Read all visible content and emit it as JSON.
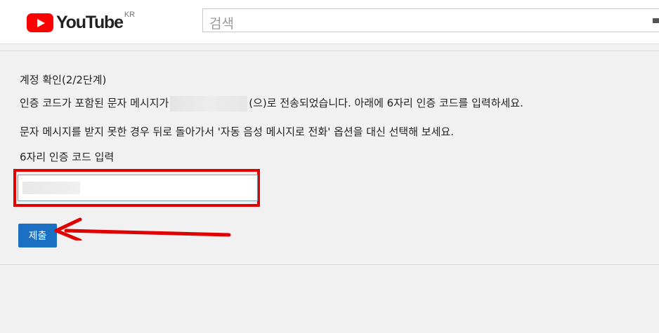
{
  "header": {
    "logo_text": "YouTube",
    "region_badge": "KR",
    "search": {
      "placeholder": "검색"
    }
  },
  "page": {
    "title": "계정 확인(2/2단계)",
    "message_part1": "인증 코드가 포함된 문자 메시지가",
    "message_part2": "(으)로 전송되었습니다. 아래에 6자리 인증 코드를 입력하세요.",
    "fallback_text": "문자 메시지를 받지 못한 경우 뒤로 돌아가서 '자동 음성 메시지로 전화' 옵션을 대신 선택해 보세요.",
    "code_label": "6자리 인증 코드 입력",
    "submit_label": "제출"
  },
  "colors": {
    "brand_red": "#ff0000",
    "highlight_red": "#e00000",
    "button_blue": "#1c70c3"
  },
  "icons": [
    "play-icon",
    "keyboard-icon",
    "red-arrow-annotation"
  ]
}
